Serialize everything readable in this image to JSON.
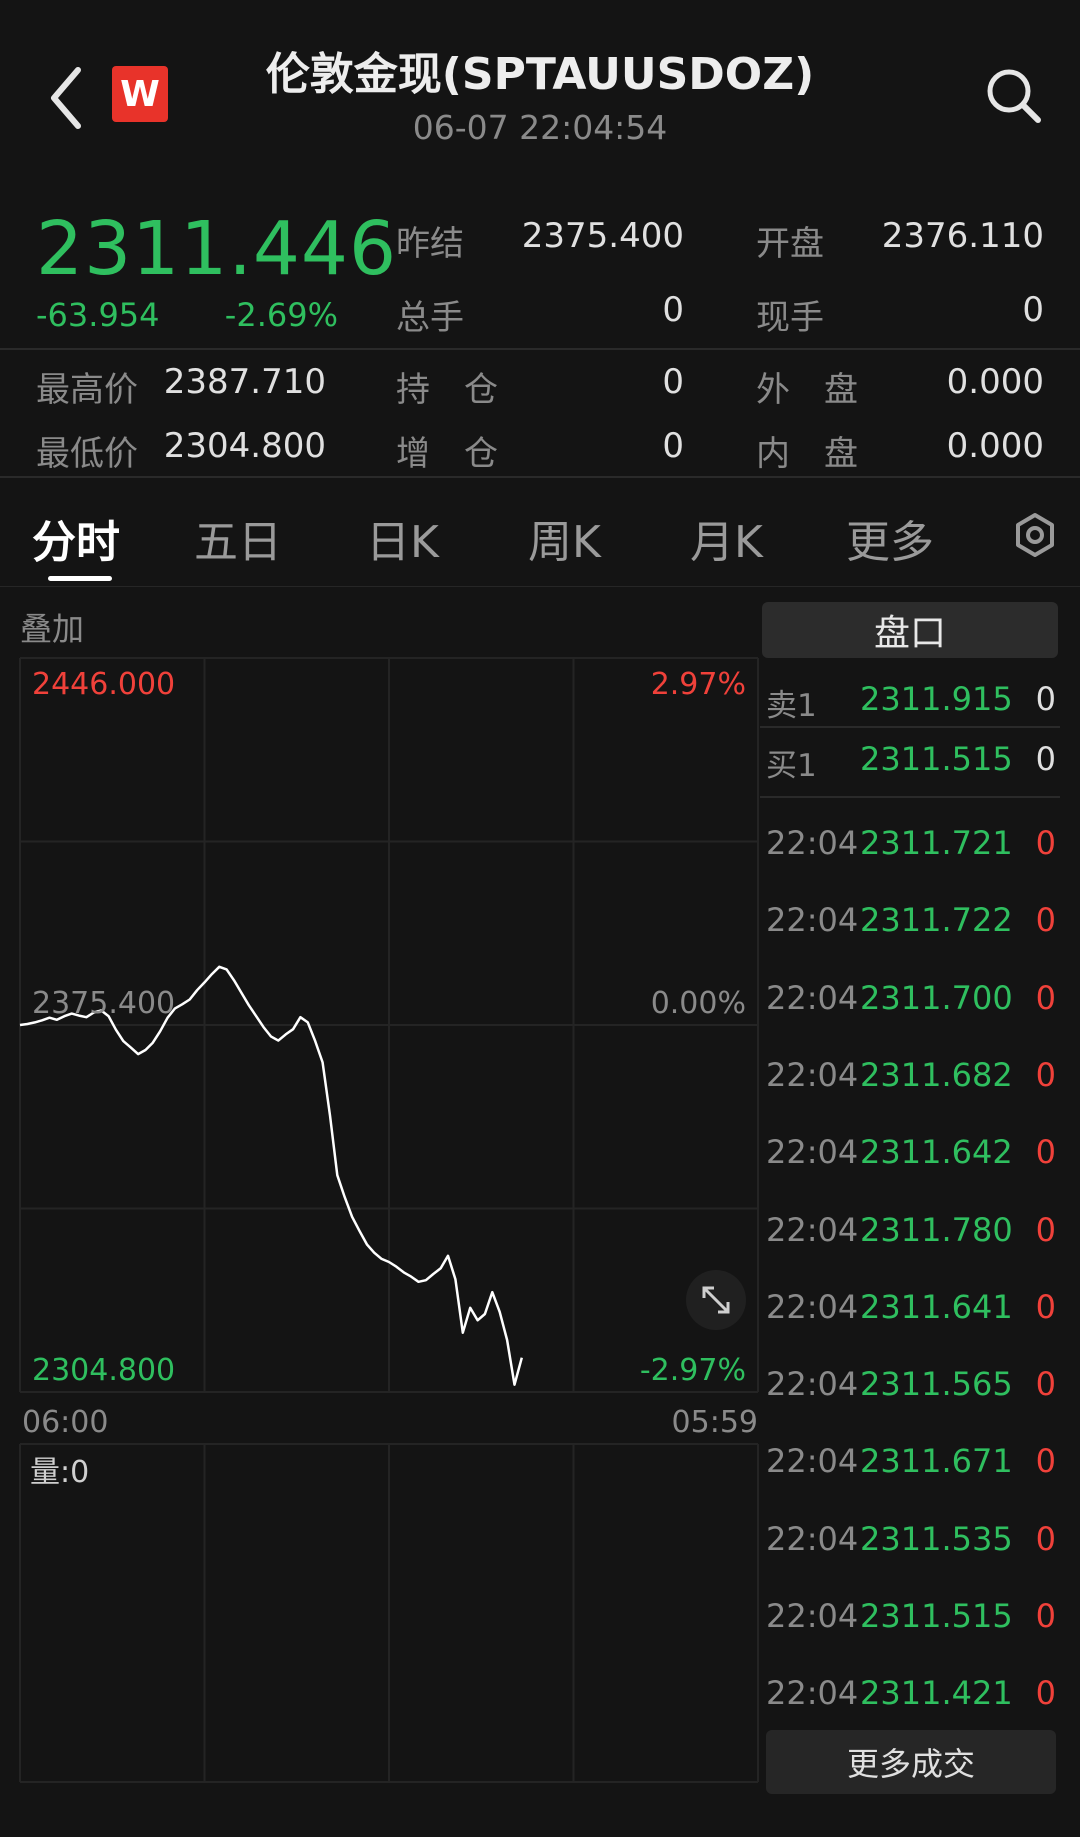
{
  "header": {
    "title": "伦敦金现(SPTAUUSDOZ)",
    "datetime": "06-07 22:04:54",
    "logo_text": "W"
  },
  "quote": {
    "price": "2311.446",
    "change": "-63.954",
    "change_pct": "-2.69%",
    "stats": [
      {
        "label": "昨结",
        "value": "2375.400"
      },
      {
        "label": "开盘",
        "value": "2376.110"
      },
      {
        "label": "总手",
        "value": "0"
      },
      {
        "label": "现手",
        "value": "0"
      },
      {
        "label": "最高价",
        "value": "2387.710"
      },
      {
        "label": "持　仓",
        "value": "0"
      },
      {
        "label": "外　盘",
        "value": "0.000"
      },
      {
        "label": "最低价",
        "value": "2304.800"
      },
      {
        "label": "增　仓",
        "value": "0"
      },
      {
        "label": "内　盘",
        "value": "0.000"
      }
    ]
  },
  "tabs": [
    {
      "label": "分时",
      "active": true
    },
    {
      "label": "五日",
      "active": false
    },
    {
      "label": "日K",
      "active": false
    },
    {
      "label": "周K",
      "active": false
    },
    {
      "label": "月K",
      "active": false
    },
    {
      "label": "更多",
      "active": false
    }
  ],
  "chart": {
    "overlay_label": "叠加",
    "volume_label": "量:0"
  },
  "chart_data": {
    "type": "line",
    "x_start_label": "06:00",
    "x_end_label": "05:59",
    "y_top_label": "2446.000",
    "y_mid_label": "2375.400",
    "y_bottom_label": "2304.800",
    "pct_top_label": "2.97%",
    "pct_mid_label": "0.00%",
    "pct_bottom_label": "-2.97%",
    "ylim": [
      2304.8,
      2446.0
    ],
    "progress_end": 0.68,
    "values": [
      2375.4,
      2375.6,
      2375.9,
      2376.3,
      2376.8,
      2376.4,
      2377.1,
      2377.6,
      2377.2,
      2376.9,
      2377.8,
      2378.2,
      2377.1,
      2374.5,
      2372.3,
      2371.1,
      2369.8,
      2370.6,
      2372.0,
      2374.2,
      2376.8,
      2378.6,
      2379.4,
      2380.3,
      2382.1,
      2383.6,
      2385.2,
      2386.6,
      2386.1,
      2384.0,
      2381.6,
      2379.2,
      2377.1,
      2375.0,
      2373.2,
      2372.4,
      2373.6,
      2374.6,
      2376.9,
      2375.9,
      2372.3,
      2368.2,
      2358.0,
      2346.5,
      2342.3,
      2338.5,
      2335.8,
      2333.2,
      2331.6,
      2330.4,
      2329.8,
      2328.9,
      2327.8,
      2327.0,
      2326.0,
      2326.3,
      2327.5,
      2328.6,
      2331.0,
      2326.5,
      2316.2,
      2321.0,
      2318.6,
      2319.8,
      2324.0,
      2320.2,
      2314.8,
      2306.2,
      2311.4
    ]
  },
  "orderbook": {
    "button_label": "盘口",
    "rows": [
      {
        "label": "卖1",
        "price": "2311.915",
        "vol": "0"
      },
      {
        "label": "买1",
        "price": "2311.515",
        "vol": "0"
      }
    ]
  },
  "trades": [
    {
      "time": "22:04",
      "price": "2311.721",
      "vol": "0"
    },
    {
      "time": "22:04",
      "price": "2311.722",
      "vol": "0"
    },
    {
      "time": "22:04",
      "price": "2311.700",
      "vol": "0"
    },
    {
      "time": "22:04",
      "price": "2311.682",
      "vol": "0"
    },
    {
      "time": "22:04",
      "price": "2311.642",
      "vol": "0"
    },
    {
      "time": "22:04",
      "price": "2311.780",
      "vol": "0"
    },
    {
      "time": "22:04",
      "price": "2311.641",
      "vol": "0"
    },
    {
      "time": "22:04",
      "price": "2311.565",
      "vol": "0"
    },
    {
      "time": "22:04",
      "price": "2311.671",
      "vol": "0"
    },
    {
      "time": "22:04",
      "price": "2311.535",
      "vol": "0"
    },
    {
      "time": "22:04",
      "price": "2311.515",
      "vol": "0"
    },
    {
      "time": "22:04",
      "price": "2311.421",
      "vol": "0"
    }
  ],
  "trades_more_label": "更多成交",
  "colors": {
    "up": "#f0413a",
    "down": "#2fbf5f",
    "line": "#ffffff"
  }
}
